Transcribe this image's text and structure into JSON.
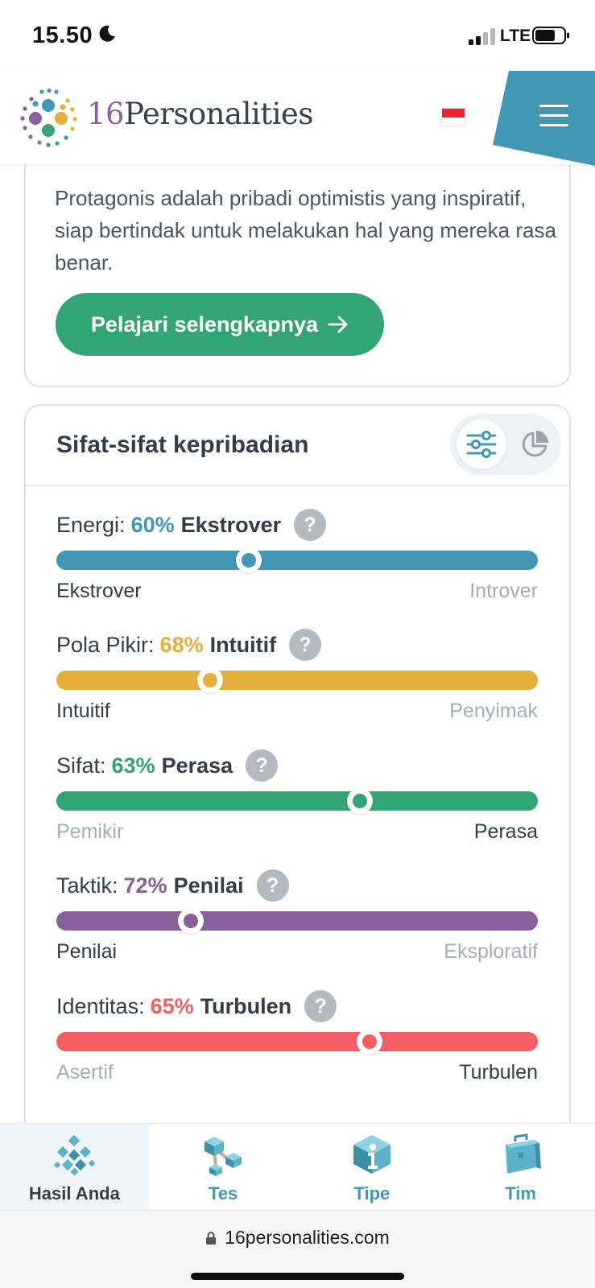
{
  "status_bar": {
    "time": "15.50",
    "network": "LTE"
  },
  "header": {
    "logo_number": "16",
    "logo_word": "Personalities",
    "language_flag": "indonesia-flag",
    "menu_icon": "hamburger-menu-icon",
    "accent_color": "#4298b4"
  },
  "description_card": {
    "text": "Protagonis adalah pribadi optimistis yang inspiratif, siap bertindak untuk melakukan hal yang mereka rasa benar.",
    "button_label": "Pelajari selengkapnya",
    "button_color": "#33a474"
  },
  "traits_card": {
    "title": "Sifat-sifat kepribadian",
    "toggle_options": [
      "sliders-icon",
      "pie-chart-icon"
    ],
    "active_toggle": "sliders-icon",
    "traits": [
      {
        "label": "Energi:",
        "percent": "60%",
        "type": "Ekstrover",
        "left": "Ekstrover",
        "right": "Introver",
        "active_side": "left",
        "position": 0.4,
        "color": "#4298b4"
      },
      {
        "label": "Pola Pikir:",
        "percent": "68%",
        "type": "Intuitif",
        "left": "Intuitif",
        "right": "Penyimak",
        "active_side": "left",
        "position": 0.32,
        "color": "#e4ae3a"
      },
      {
        "label": "Sifat:",
        "percent": "63%",
        "type": "Perasa",
        "left": "Pemikir",
        "right": "Perasa",
        "active_side": "right",
        "position": 0.63,
        "color": "#33a474"
      },
      {
        "label": "Taktik:",
        "percent": "72%",
        "type": "Penilai",
        "left": "Penilai",
        "right": "Eksploratif",
        "active_side": "left",
        "position": 0.28,
        "color": "#88619a"
      },
      {
        "label": "Identitas:",
        "percent": "65%",
        "type": "Turbulen",
        "left": "Asertif",
        "right": "Turbulen",
        "active_side": "right",
        "position": 0.65,
        "color": "#f25e62"
      }
    ]
  },
  "bottom_nav": {
    "items": [
      {
        "label": "Hasil Anda",
        "icon": "results-cubes-icon",
        "active": true
      },
      {
        "label": "Tes",
        "icon": "test-molecule-icon",
        "active": false
      },
      {
        "label": "Tipe",
        "icon": "types-info-icon",
        "active": false
      },
      {
        "label": "Tim",
        "icon": "team-briefcase-icon",
        "active": false
      }
    ]
  },
  "browser": {
    "url": "16personalities.com"
  }
}
